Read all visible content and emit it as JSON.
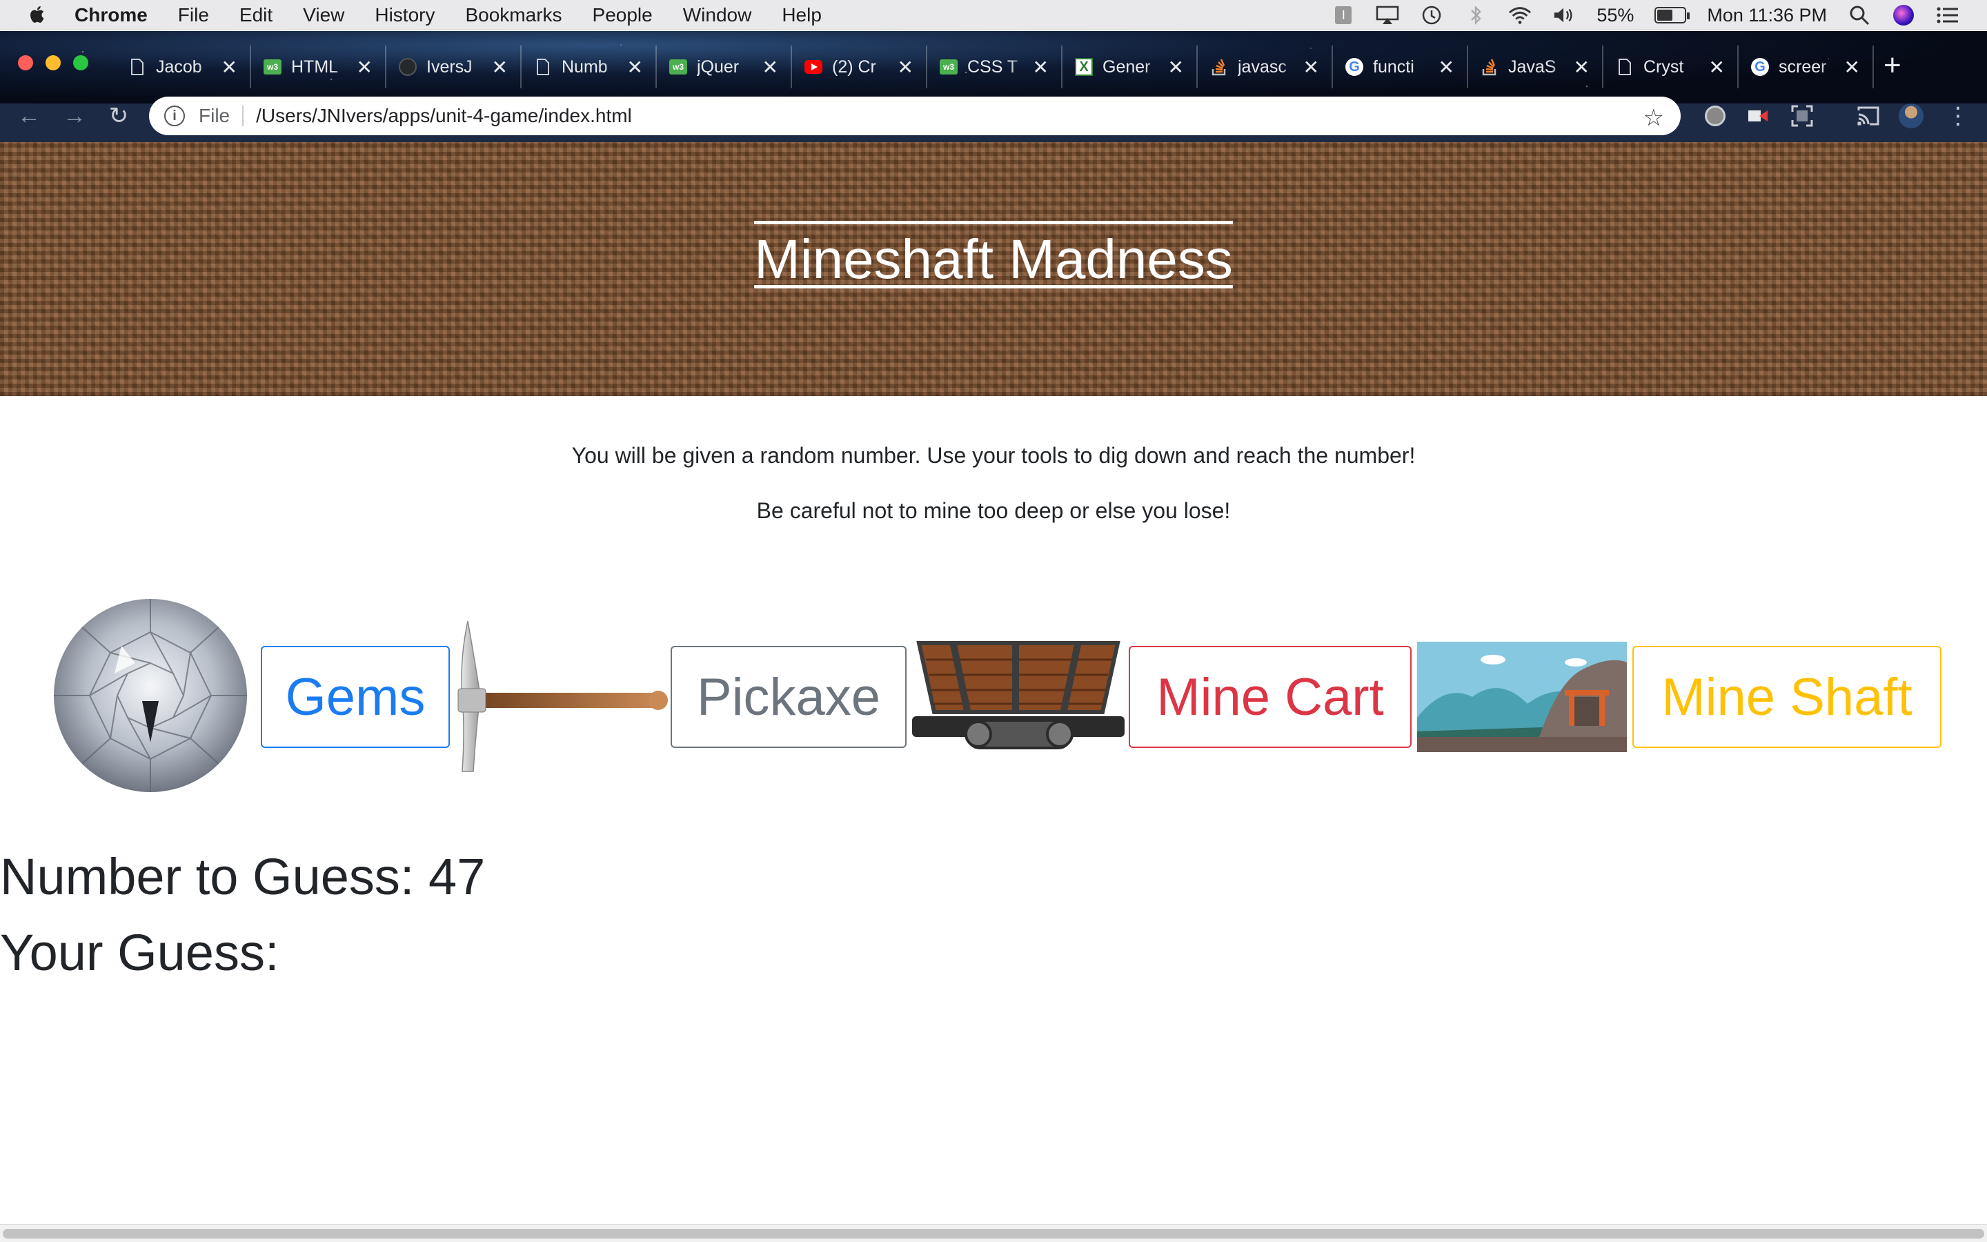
{
  "menubar": {
    "app": "Chrome",
    "items": [
      "File",
      "Edit",
      "View",
      "History",
      "Bookmarks",
      "People",
      "Window",
      "Help"
    ],
    "battery": "55%",
    "clock": "Mon 11:36 PM"
  },
  "tabs": [
    {
      "title": "Jacob",
      "icon": "document-icon"
    },
    {
      "title": "HTML",
      "icon": "w3schools-icon"
    },
    {
      "title": "IversJ",
      "icon": "github-icon"
    },
    {
      "title": "Numb",
      "icon": "document-icon"
    },
    {
      "title": "jQuer",
      "icon": "w3schools-icon"
    },
    {
      "title": "(2) Cr",
      "icon": "youtube-icon"
    },
    {
      "title": "CSS T",
      "icon": "w3schools-icon"
    },
    {
      "title": "Gener",
      "icon": "generator-icon"
    },
    {
      "title": "javasc",
      "icon": "stackoverflow-icon"
    },
    {
      "title": "functi",
      "icon": "google-icon"
    },
    {
      "title": "JavaS",
      "icon": "stackoverflow-icon"
    },
    {
      "title": "Cryst",
      "icon": "document-icon"
    },
    {
      "title": "screer",
      "icon": "google-icon"
    }
  ],
  "omnibox": {
    "scheme_label": "File",
    "url": "/Users/JNIvers/apps/unit-4-game/index.html"
  },
  "page": {
    "title": "Mineshaft Madness",
    "intro_line1": "You will be given a random number. Use your tools to dig down and reach the number!",
    "intro_line2": "Be careful not to mine too deep or else you lose!",
    "buttons": {
      "gems": "Gems",
      "pickaxe": "Pickaxe",
      "mine_cart": "Mine Cart",
      "mine_shaft": "Mine Shaft"
    },
    "number_label": "Number to Guess: 47",
    "guess_label": "Your Guess:"
  },
  "colors": {
    "gems": "#1a7cf2",
    "pickaxe": "#6c757d",
    "mine_cart": "#dc3545",
    "mine_shaft": "#ffc107"
  }
}
